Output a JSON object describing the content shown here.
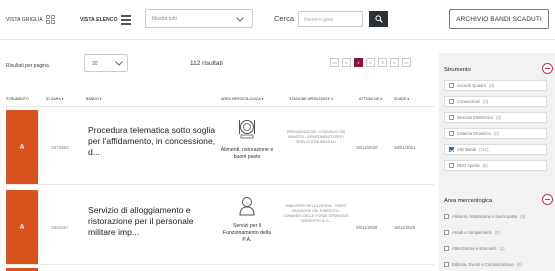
{
  "topbar": {
    "grid_view_label": "VISTA GRIGLIA",
    "list_view_label": "VISTA ELENCO",
    "filter_select_value": "Mostra tutti",
    "search_label": "Cerca",
    "search_placeholder": "Numero gara",
    "archive_button_label": "ARCHIVIO BANDI SCADUTI"
  },
  "toolbar": {
    "results_per_page_label": "Risultati per pagina",
    "results_per_page_value": "20",
    "results_count": "112 risultati",
    "pager": [
      "<<",
      "<",
      "1",
      "2",
      "3",
      ">",
      ">>"
    ],
    "pager_active": "1"
  },
  "table": {
    "headers": {
      "strumento": "STRUMENTO",
      "id": "ID GARA ▾",
      "bando": "BANDO ▾",
      "area": "AREA MERCEOLOGICA ▾",
      "stazione": "STAZIONE APPALTANTE ▾",
      "attivazione": "ATTIVAZ.NE ▾",
      "scadenza": "SCADE.▾"
    },
    "rows": [
      {
        "flag": "A",
        "code": "2672982",
        "title": "Procedura telematica sotto soglia per l'affidamento, in concessione, d...",
        "area_icon": "food-service-icon",
        "area_label": "Alimenti, ristorazione e buoni pasto",
        "station": "PRESIDENZA DEL CONSIGLIO DEI MINISTRI - DIPARTIMENTO PER I SERVIZI STRUMENTALI",
        "start_date": "18/12/2020",
        "end_date": "18/01/2021"
      },
      {
        "flag": "A",
        "code": "2682957",
        "title": "Servizio di alloggiamento e ristorazione per il personale militare imp...",
        "area_icon": "person-service-icon",
        "area_label": "Servizi per il Funzionamento della P.A.",
        "station": "MINISTERO DELLA DIFESA - STATO MAGGIORE DEL ESERCITO - COMANDO DELLE FORZE OPERATIVE TERRESTRI DI S...",
        "start_date": "09/11/2020",
        "end_date": "16/11/2020"
      }
    ]
  },
  "sidebar": {
    "strumento_title": "Strumento",
    "strumento_items": [
      {
        "label": "Accordi Quadro",
        "count": "(0)",
        "checked": false
      },
      {
        "label": "Convenzioni",
        "count": "(0)",
        "checked": false
      },
      {
        "label": "Mercato Elettronico",
        "count": "(0)",
        "checked": false
      },
      {
        "label": "Sistema Dinamico",
        "count": "(0)",
        "checked": false
      },
      {
        "label": "Altri Bandi",
        "count": "(112)",
        "checked": true
      },
      {
        "label": "RDO Aperta",
        "count": "(0)",
        "checked": false
      }
    ],
    "area_title": "Area merceologica",
    "area_items": [
      {
        "label": "Alimenti, ristorazione e buoni pasto",
        "count": "(5)"
      },
      {
        "label": "Arredi e complementi",
        "count": "(0)"
      },
      {
        "label": "Attrezzature e strumenti",
        "count": "(1)"
      },
      {
        "label": "Editoria, Eventi e Comunicazione",
        "count": "(0)"
      }
    ]
  },
  "colors": {
    "accent": "#8b1538",
    "flag": "#d9531e",
    "checkbox": "#2d6fb7",
    "search_button": "#2b3134"
  }
}
